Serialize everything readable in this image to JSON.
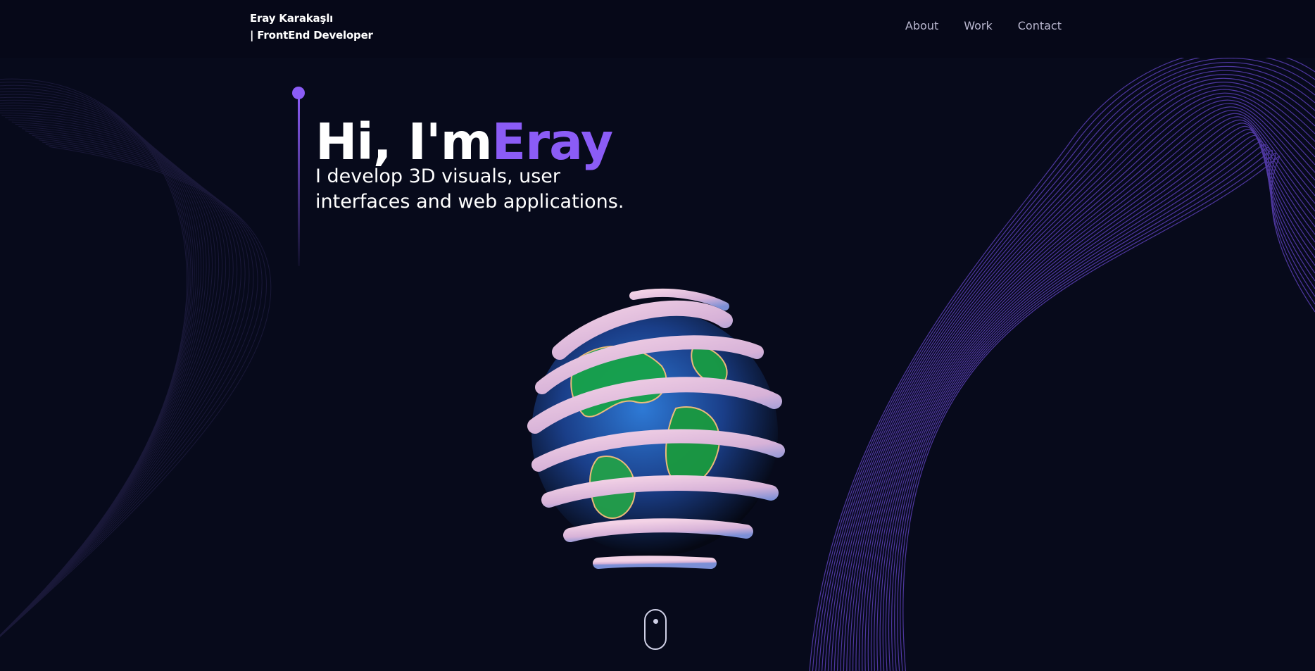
{
  "header": {
    "brand_name": "Eray Karakaşlı",
    "brand_role": "| FrontEnd Developer",
    "nav": [
      "About",
      "Work",
      "Contact"
    ]
  },
  "hero": {
    "greeting": "Hi, I'm",
    "name": "Eray",
    "subtitle": "I develop 3D visuals, user interfaces and web applications."
  },
  "colors": {
    "background": "#060818",
    "accent": "#8b5cf6",
    "text": "#ffffff",
    "nav_text": "#b9b7cf"
  },
  "icons": [
    "mouse-scroll-icon"
  ]
}
